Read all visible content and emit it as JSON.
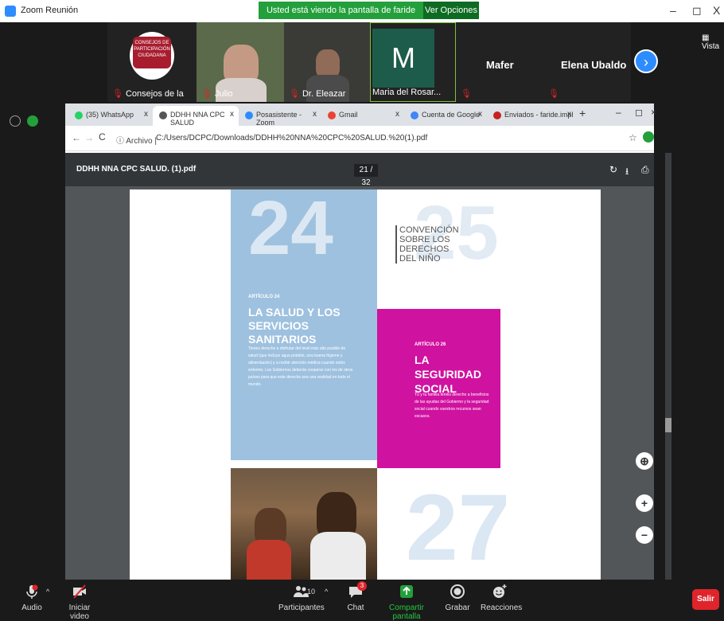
{
  "zoom_window": {
    "title": "Zoom Reunión",
    "share_banner": "Usted está viendo la pantalla de faride implan",
    "view_options": "Ver Opciones ⌄",
    "vista": "Vista"
  },
  "participants": [
    {
      "name": "Consejos de la"
    },
    {
      "name": "Julio"
    },
    {
      "name": "Dr. Eleazar"
    },
    {
      "name": "Maria del Rosar..."
    },
    {
      "name": "Mafer"
    },
    {
      "name": "Elena Ubaldo"
    }
  ],
  "logo_text": "CONSEJOS DE PARTICIPACIÓN CIUDADANA",
  "m_letter": "M",
  "browser": {
    "tabs": [
      {
        "label": "(35) WhatsApp",
        "color": "#25d366"
      },
      {
        "label": "DDHH NNA CPC SALUD",
        "color": "#555555"
      },
      {
        "label": "Posasistente - Zoom",
        "color": "#2d8cff"
      },
      {
        "label": "Gmail",
        "color": "#ea4335"
      },
      {
        "label": "Cuenta de Google",
        "color": "#4285f4"
      },
      {
        "label": "Enviados - faride.impl",
        "color": "#c5221f"
      }
    ],
    "new_tab": "+",
    "address_label": "Archivo",
    "address": "C:/Users/DCPC/Downloads/DDHH%20NNA%20CPC%20SALUD.%20(1).pdf"
  },
  "pdf": {
    "title": "DDHH NNA CPC SALUD. (1).pdf",
    "page_indicator": "21 / 32",
    "big_24": "24",
    "big_25": "25",
    "big_27": "27",
    "convention": [
      "CONVENCIÓN",
      "SOBRE LOS",
      "DERECHOS",
      "DEL NIÑO"
    ],
    "art24_label": "ARTÍCULO 24",
    "art24_title": "LA SALUD Y LOS SERVICIOS SANITARIOS",
    "art24_body": "Tienes derecho a disfrutar del nivel más alto posible de salud (que incluye agua potable, una buena higiene y alimentación) y a recibir atención médica cuando estés enfermo. Los Gobiernos deberán cooperar con los de otros países para que este derecho sea una realidad en todo el mundo.",
    "art26_label": "ARTÍCULO 26",
    "art26_title": "LA SEGURIDAD SOCIAL",
    "art26_body": "Tú y tu familia tenéis derecho a beneficios de las ayudas del Gobierno y la seguridad social cuando vuestros recursos sean escasos."
  },
  "toolbar": {
    "audio": "Audio",
    "video": "Iniciar video",
    "participants": "Participantes",
    "participants_count": "10",
    "chat": "Chat",
    "chat_badge": "3",
    "share": "Compartir pantalla",
    "record": "Grabar",
    "reactions": "Reacciones",
    "leave": "Salir"
  },
  "colors": {
    "zoom_blue": "#2d8cff",
    "share_green": "#23a03b",
    "pink": "#d012a0",
    "blue_col": "#9ec1df",
    "leave_red": "#e0242b"
  }
}
